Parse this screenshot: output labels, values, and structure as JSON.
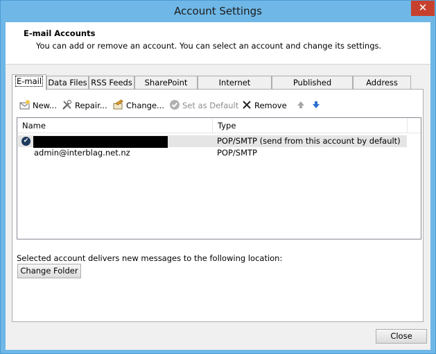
{
  "window": {
    "title": "Account Settings",
    "close_glyph": "✕"
  },
  "header": {
    "title": "E-mail Accounts",
    "description": "You can add or remove an account. You can select an account and change its settings."
  },
  "tabs": [
    {
      "label": "E-mail",
      "active": true
    },
    {
      "label": "Data Files"
    },
    {
      "label": "RSS Feeds"
    },
    {
      "label": "SharePoint Lists"
    },
    {
      "label": "Internet Calendars"
    },
    {
      "label": "Published Calendars"
    },
    {
      "label": "Address Books"
    }
  ],
  "toolbar": {
    "new_label": "New...",
    "repair_label": "Repair...",
    "change_label": "Change...",
    "set_default_label": "Set as Default",
    "remove_label": "Remove"
  },
  "accounts_list": {
    "columns": {
      "name": "Name",
      "type": "Type"
    },
    "rows": [
      {
        "name": "",
        "type": "POP/SMTP (send from this account by default)",
        "default": true,
        "redacted": true
      },
      {
        "name": "admin@interblag.net.nz",
        "type": "POP/SMTP",
        "default": false
      }
    ]
  },
  "delivery": {
    "text": "Selected account delivers new messages to the following location:",
    "change_folder_label": "Change Folder"
  },
  "footer": {
    "close_label": "Close"
  }
}
